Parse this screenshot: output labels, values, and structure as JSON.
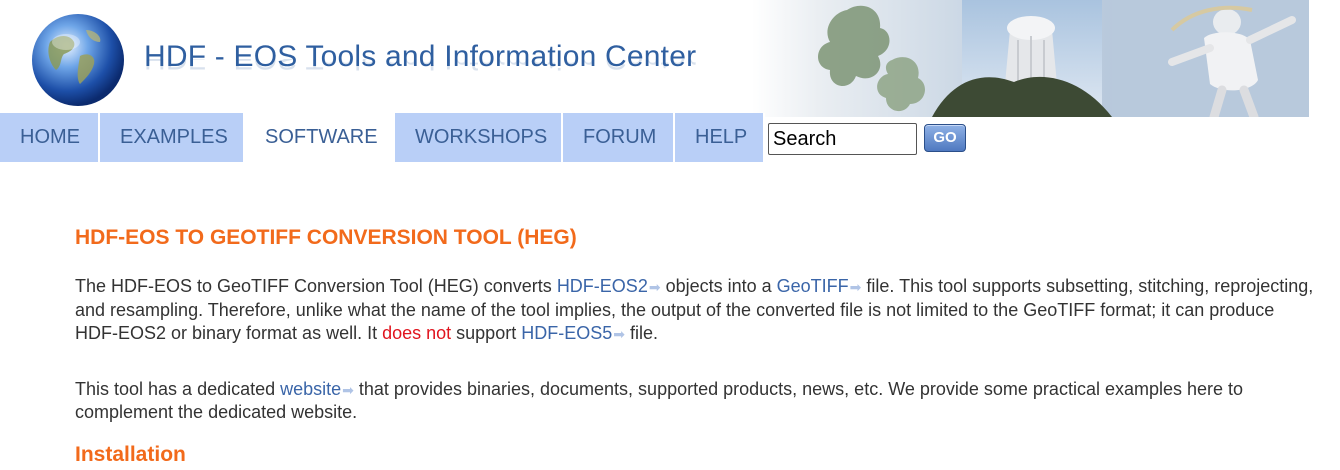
{
  "header": {
    "site_title": "HDF - EOS Tools and Information Center",
    "logo_icon": "globe-icon"
  },
  "nav": {
    "items": [
      {
        "label": "HOME"
      },
      {
        "label": "EXAMPLES"
      },
      {
        "label": "SOFTWARE",
        "active": true
      },
      {
        "label": "WORKSHOPS"
      },
      {
        "label": "FORUM"
      },
      {
        "label": "HELP"
      }
    ],
    "search_value": "Search",
    "go_label": "GO"
  },
  "main": {
    "title": "HDF-EOS TO GEOTIFF CONVERSION TOOL (HEG)",
    "p1": {
      "t1": "The HDF-EOS to GeoTIFF Conversion Tool (HEG) converts ",
      "link1": "HDF-EOS2",
      "t2": " objects into a ",
      "link2": "GeoTIFF",
      "t3": " file. This tool supports subsetting, stitching, reprojecting, and resampling. Therefore, unlike what the name of the tool implies, the output of the converted file is not limited to the GeoTIFF format; it can produce HDF-EOS2 or binary format as well. It ",
      "warn": "does not",
      "t4": " support ",
      "link3": "HDF-EOS5",
      "t5": " file."
    },
    "p2": {
      "t1": "This tool has a dedicated ",
      "link": "website",
      "t2": " that provides binaries, documents, supported products, news, etc. We provide some practical examples here to",
      "t3": "complement the dedicated website."
    },
    "installation_heading": "Installation"
  },
  "colors": {
    "heading": "#f26a1b",
    "link": "#3a65a8",
    "nav_bg": "#b9cff7",
    "nav_text": "#3a5f95",
    "warning": "#e0141e"
  }
}
